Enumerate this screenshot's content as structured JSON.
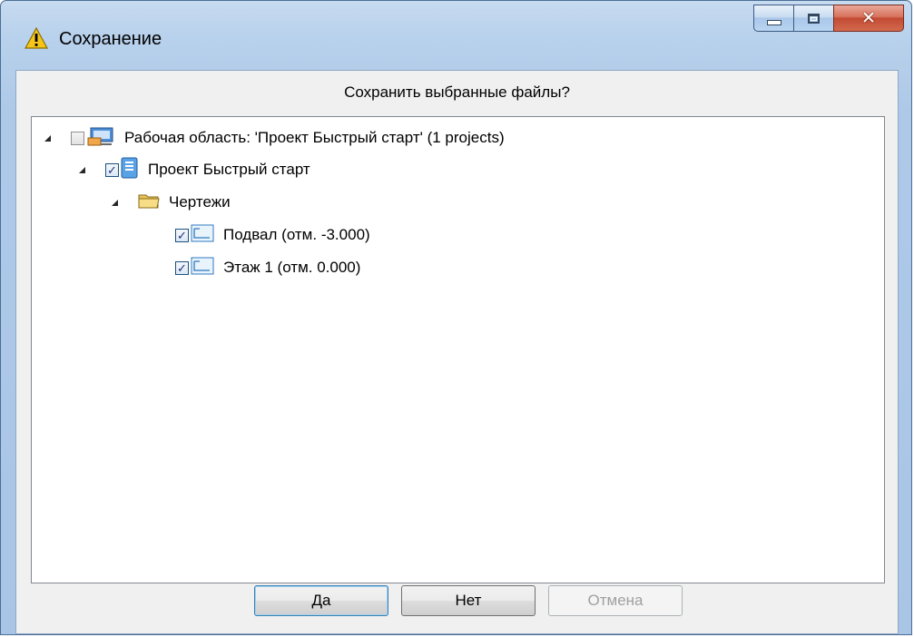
{
  "window": {
    "title": "Сохранение",
    "title_icon": "warning-icon"
  },
  "dialog": {
    "question": "Сохранить выбранные файлы?"
  },
  "tree": [
    {
      "label": "Рабочая область: 'Проект Быстрый старт' (1 projects)",
      "checked": false,
      "icon": "workspace-icon",
      "expanded": true
    },
    {
      "label": "Проект Быстрый старт",
      "checked": true,
      "icon": "project-icon",
      "expanded": true
    },
    {
      "label": "Чертежи",
      "icon": "folder-icon",
      "expanded": true
    },
    {
      "label": "Подвал (отм. -3.000)",
      "checked": true,
      "icon": "drawing-icon"
    },
    {
      "label": "Этаж 1 (отм. 0.000)",
      "checked": true,
      "icon": "drawing-icon"
    }
  ],
  "buttons": {
    "yes": "Да",
    "no": "Нет",
    "cancel": "Отмена"
  },
  "colors": {
    "frame": "#b8d1ec",
    "close_button": "#c34a33",
    "default_button_border": "#3c7fb1"
  }
}
